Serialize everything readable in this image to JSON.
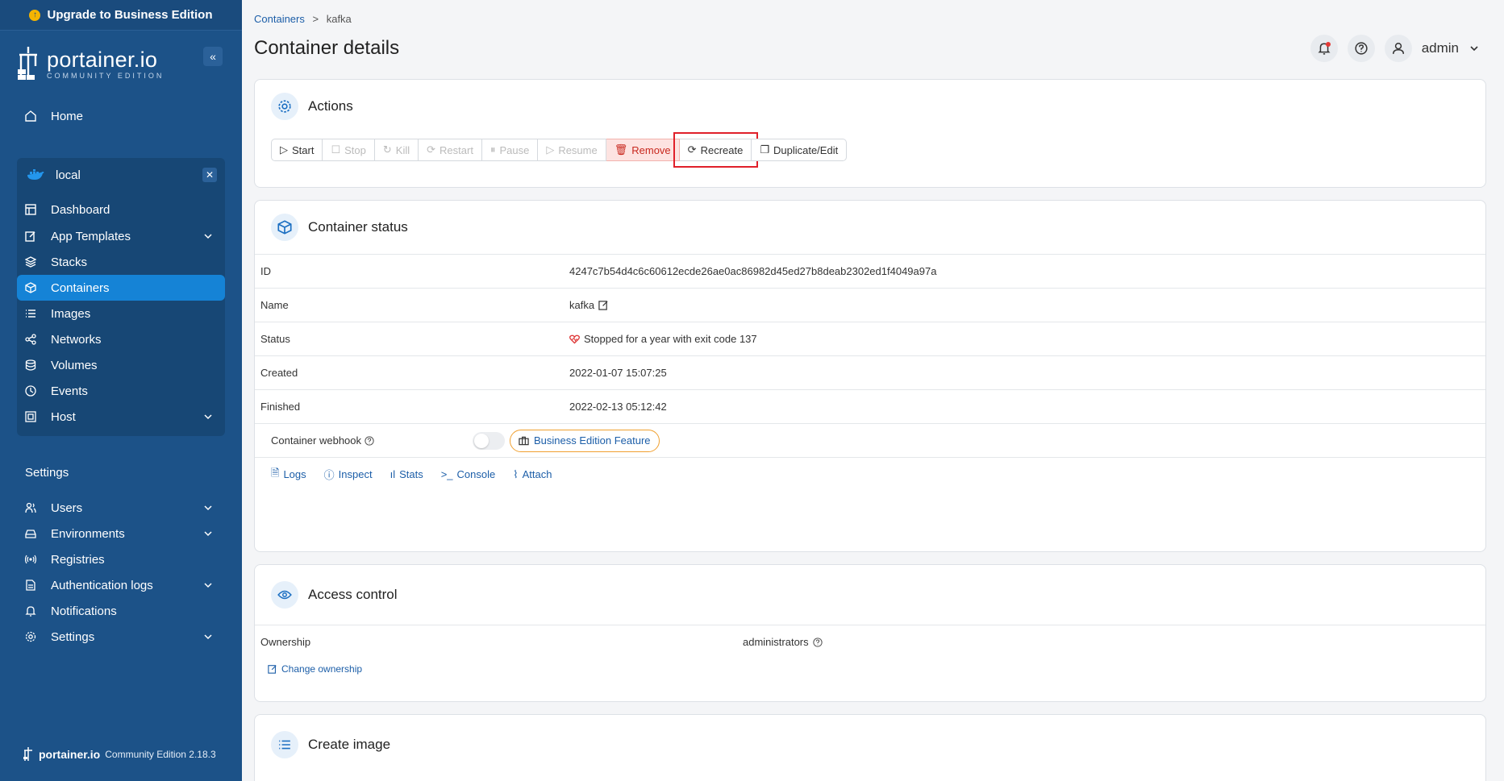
{
  "sidebar": {
    "upgrade_label": "Upgrade to Business Edition",
    "brand_name": "portainer.io",
    "brand_sub": "COMMUNITY EDITION",
    "home": "Home",
    "environment": {
      "name": "local",
      "items": [
        "Dashboard",
        "App Templates",
        "Stacks",
        "Containers",
        "Images",
        "Networks",
        "Volumes",
        "Events",
        "Host"
      ],
      "active": "Containers"
    },
    "settings_title": "Settings",
    "settings_items": [
      "Users",
      "Environments",
      "Registries",
      "Authentication logs",
      "Notifications",
      "Settings"
    ],
    "footer_brand": "portainer.io",
    "footer_version": "Community Edition 2.18.3"
  },
  "header": {
    "breadcrumb": {
      "parent": "Containers",
      "separator": ">",
      "current": "kafka"
    },
    "title": "Container details",
    "user": "admin"
  },
  "actions": {
    "title": "Actions",
    "buttons": [
      "Start",
      "Stop",
      "Kill",
      "Restart",
      "Pause",
      "Resume",
      "Remove",
      "Recreate",
      "Duplicate/Edit"
    ]
  },
  "status": {
    "title": "Container status",
    "rows": [
      {
        "key": "ID",
        "value": "4247c7b54d4c6c60612ecde26ae0ac86982d45ed27b8deab2302ed1f4049a97a"
      },
      {
        "key": "Name",
        "value": "kafka"
      },
      {
        "key": "Status",
        "value": "Stopped for a year with exit code 137"
      },
      {
        "key": "Created",
        "value": "2022-01-07 15:07:25"
      },
      {
        "key": "Finished",
        "value": "2022-02-13 05:12:42"
      }
    ],
    "webhook_label": "Container webhook",
    "be_feature": "Business Edition Feature",
    "links": [
      "Logs",
      "Inspect",
      "Stats",
      "Console",
      "Attach"
    ]
  },
  "access": {
    "title": "Access control",
    "ownership_label": "Ownership",
    "ownership_value": "administrators",
    "change_ownership": "Change ownership"
  },
  "create_image": {
    "title": "Create image"
  },
  "colors": {
    "sidebar": "#1c5288",
    "active": "#1583d6",
    "link": "#1c5ea8",
    "remove": "#c8281e"
  }
}
